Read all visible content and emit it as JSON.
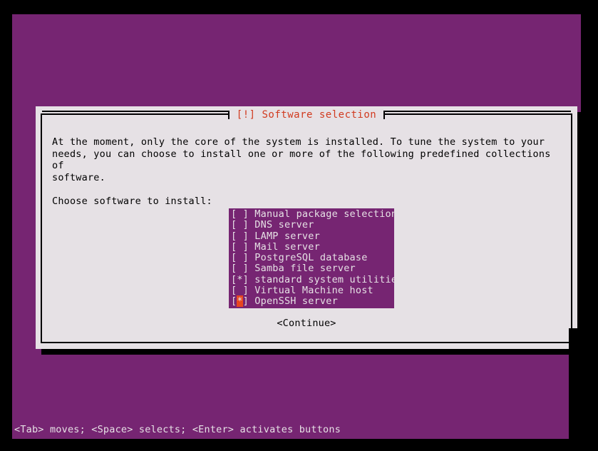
{
  "screen": {
    "background_color": "#000000",
    "console_background_color": "#762572",
    "text_color": "#e6e1e5"
  },
  "dialog": {
    "title": "[!] Software selection",
    "title_color": "#d13a1f",
    "background_color": "#e6e1e5",
    "border_color": "#000000",
    "paragraphs": [
      "At the moment, only the core of the system is installed. To tune the system to your\nneeds, you can choose to install one or more of the following predefined collections of\nsoftware.",
      "Choose software to install:"
    ],
    "prompt": "Choose software to install:",
    "continue_label": "<Continue>"
  },
  "software_list": {
    "background_color": "#762572",
    "text_color": "#e6e1e5",
    "cursor_color": "#e8461f",
    "items": [
      {
        "label": "Manual package selection",
        "checked": false,
        "cursor": false,
        "checkbox": "[ ]"
      },
      {
        "label": "DNS server",
        "checked": false,
        "cursor": false,
        "checkbox": "[ ]"
      },
      {
        "label": "LAMP server",
        "checked": false,
        "cursor": false,
        "checkbox": "[ ]"
      },
      {
        "label": "Mail server",
        "checked": false,
        "cursor": false,
        "checkbox": "[ ]"
      },
      {
        "label": "PostgreSQL database",
        "checked": false,
        "cursor": false,
        "checkbox": "[ ]"
      },
      {
        "label": "Samba file server",
        "checked": false,
        "cursor": false,
        "checkbox": "[ ]"
      },
      {
        "label": "standard system utilities",
        "checked": true,
        "cursor": false,
        "checkbox": "[*]"
      },
      {
        "label": "Virtual Machine host",
        "checked": false,
        "cursor": false,
        "checkbox": "[ ]"
      },
      {
        "label": "OpenSSH server",
        "checked": true,
        "cursor": true,
        "checkbox": "[*]"
      }
    ]
  },
  "statusbar": {
    "text": "<Tab> moves; <Space> selects; <Enter> activates buttons"
  }
}
